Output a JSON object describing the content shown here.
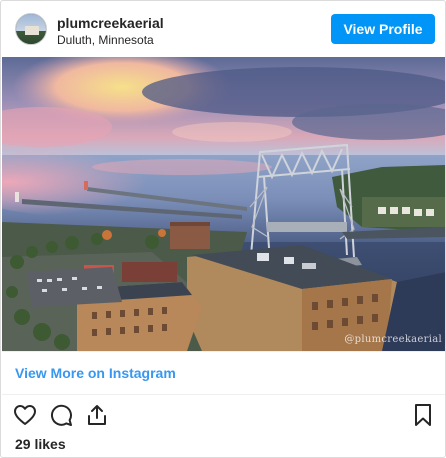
{
  "post": {
    "username": "plumcreekaerial",
    "location": "Duluth, Minnesota",
    "view_profile_label": "View Profile",
    "watermark": "@plumcreekaerial",
    "view_more_label": "View More on Instagram",
    "likes": "29 likes"
  },
  "icons": {
    "like": "heart-icon",
    "comment": "comment-icon",
    "share": "share-icon",
    "save": "bookmark-icon"
  },
  "colors": {
    "button_blue": "#0095f6",
    "link_blue": "#3897f0",
    "text": "#262626"
  }
}
